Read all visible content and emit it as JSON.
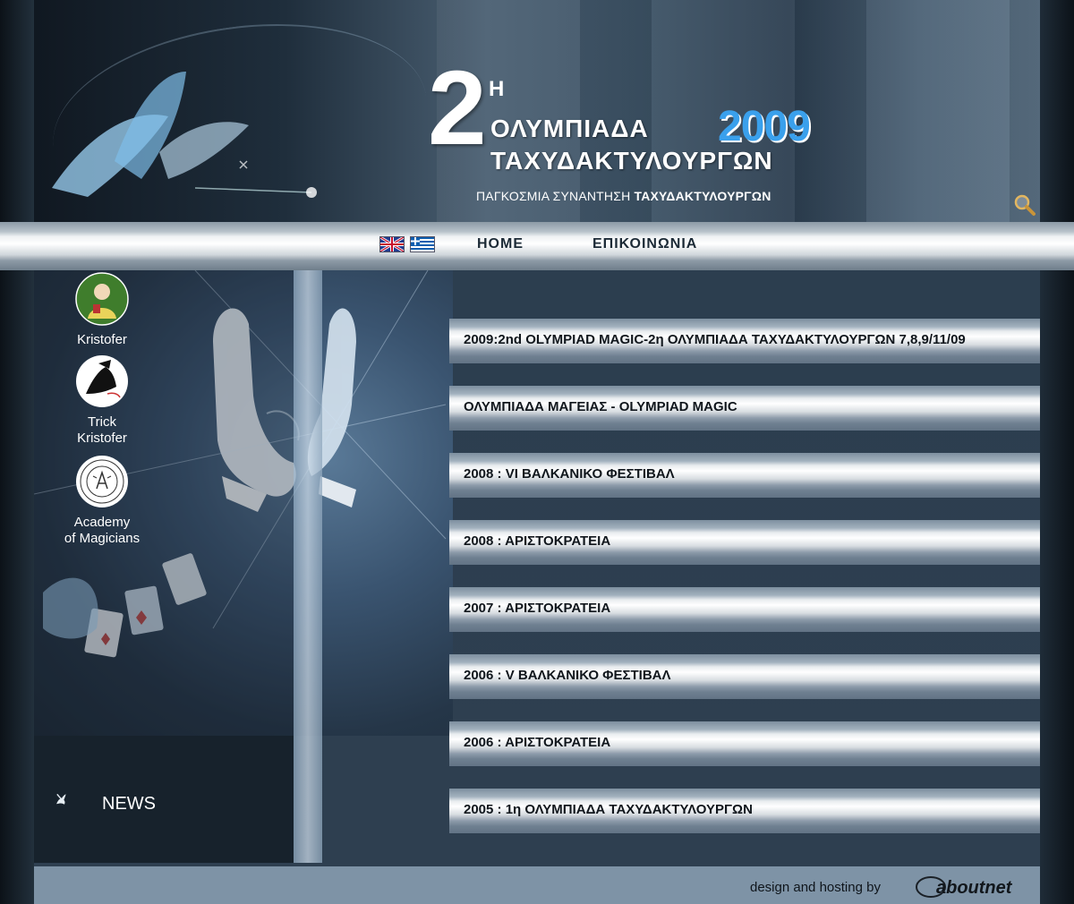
{
  "header": {
    "numeral": "2",
    "superscript": "Η",
    "title_line1": "ΟΛΥΜΠΙΑΔΑ",
    "title_line2": "ΤΑΧΥΔΑΚΤΥΛΟΥΡΓΩΝ",
    "year": "2009",
    "subtitle_plain": "ΠΑΓΚΟΣΜΙΑ ΣΥΝΑΝΤΗΣΗ ",
    "subtitle_bold": "ΤΑΧΥΔΑΚΤΥΛΟΥΡΓΩΝ",
    "search_icon": "magnifier-icon"
  },
  "nav": {
    "flags": [
      "uk-flag-icon",
      "greek-flag-icon"
    ],
    "home": "HOME",
    "contact": "ΕΠΙΚΟΙΝΩΝΙΑ"
  },
  "sidebar": {
    "items": [
      {
        "label": "Kristofer",
        "icon": "kristofer-avatar-icon"
      },
      {
        "label_line1": "Trick",
        "label_line2": "Kristofer",
        "icon": "trick-kristofer-logo-icon"
      },
      {
        "label_line1": "Academy",
        "label_line2": "of Magicians",
        "icon": "academy-seal-icon"
      }
    ],
    "news": {
      "label": "NEWS",
      "icon": "dove-icon"
    }
  },
  "news_list": [
    "2009:2nd OLYMPIAD MAGIC-2η ΟΛΥΜΠΙΑΔΑ ΤΑΧΥΔΑΚΤΥΛΟΥΡΓΩΝ 7,8,9/11/09",
    "ΟΛΥΜΠΙΑΔΑ ΜΑΓΕΙΑΣ - OLYMPIAD MAGIC",
    "2008 : VI ΒΑΛΚΑΝΙΚΟ ΦΕΣΤΙΒΑΛ",
    "2008 : ΑΡΙΣΤΟΚΡΑΤΕΙΑ",
    "2007 : ΑΡΙΣΤΟΚΡΑΤΕΙΑ",
    "2006 : V ΒΑΛΚΑΝΙΚΟ ΦΕΣΤΙΒΑΛ",
    "2006 : ΑΡΙΣΤΟΚΡΑΤΕΙΑ",
    "2005 : 1η ΟΛΥΜΠΙΑΔΑ ΤΑΧΥΔΑΚΤΥΛΟΥΡΓΩΝ"
  ],
  "footer": {
    "credit": "design and hosting by",
    "brand": "aboutnet"
  },
  "colors": {
    "accent_year": "#3aa0ec",
    "footer_bg": "#7e93a6"
  }
}
